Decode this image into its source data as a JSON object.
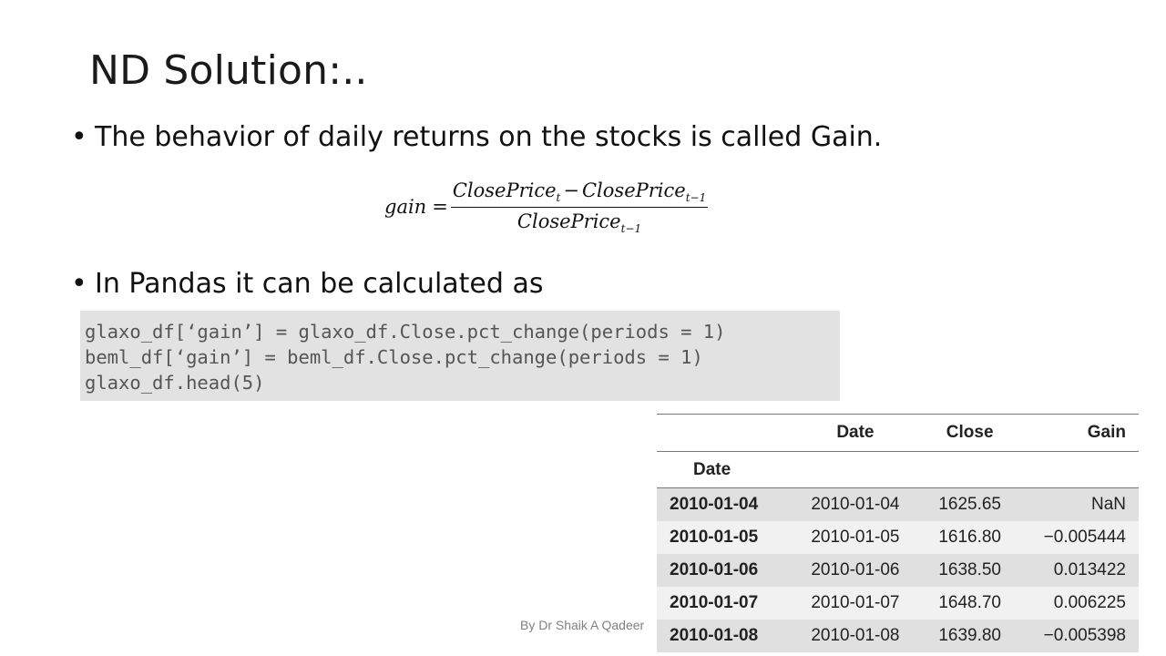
{
  "slide": {
    "title": "ND Solution:..",
    "bullets": [
      "The behavior of daily returns on the stocks is called Gain.",
      "In Pandas it can be calculated as"
    ],
    "bullet_symbol": "•"
  },
  "formula": {
    "lhs": "gain",
    "equals": "=",
    "num_term1": "ClosePrice",
    "num_term1_sub": "t",
    "minus": "−",
    "num_term2": "ClosePrice",
    "num_term2_sub": "t−1",
    "den_term": "ClosePrice",
    "den_sub": "t−1"
  },
  "code": {
    "lines": [
      "glaxo_df[‘gain’] = glaxo_df.Close.pct_change(periods = 1)",
      "beml_df[‘gain’] = beml_df.Close.pct_change(periods = 1)",
      "glaxo_df.head(5)"
    ]
  },
  "table": {
    "columns": [
      "",
      "Date",
      "Close",
      "Gain"
    ],
    "index_name": "Date",
    "rows": [
      {
        "index": "2010-01-04",
        "date": "2010-01-04",
        "close": "1625.65",
        "gain": "NaN"
      },
      {
        "index": "2010-01-05",
        "date": "2010-01-05",
        "close": "1616.80",
        "gain": "−0.005444"
      },
      {
        "index": "2010-01-06",
        "date": "2010-01-06",
        "close": "1638.50",
        "gain": "0.013422"
      },
      {
        "index": "2010-01-07",
        "date": "2010-01-07",
        "close": "1648.70",
        "gain": "0.006225"
      },
      {
        "index": "2010-01-08",
        "date": "2010-01-08",
        "close": "1639.80",
        "gain": "−0.005398"
      }
    ]
  },
  "footer": {
    "credit": "By Dr Shaik A Qadeer"
  }
}
